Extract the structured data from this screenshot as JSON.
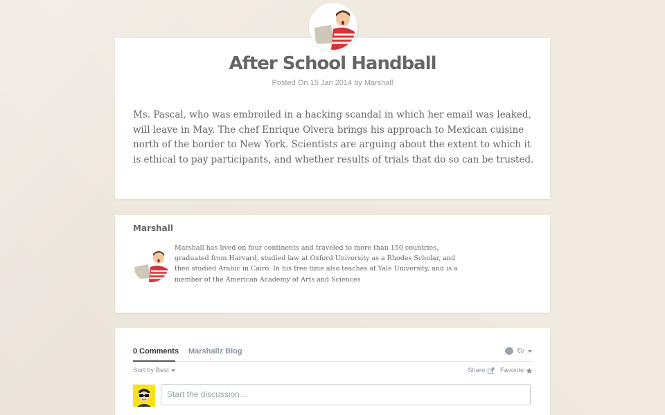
{
  "post": {
    "title": "After School Handball",
    "meta": "Posted On 15 Jan 2014 by Marshall",
    "body": "Ms. Pascal, who was embroiled in a hacking scandal in which her email was leaked, will leave in May. The chef Enrique Olvera brings his approach to Mexican cuisine north of the border to New York. Scientists are arguing about the extent to which it is ethical to pay participants, and whether results of trials that do so can be trusted."
  },
  "author": {
    "name": "Marshall",
    "bio": "Marshall has lived on four continents and traveled to more than 150 countries, graduated from Harvard, studied law at Oxford University as a Rhodes Scholar, and then studied Arabic in Cairo. In his free time also teaches at Yale University, and is a member of the American Academy of Arts and Sciences"
  },
  "comments": {
    "count_tab": "0 Comments",
    "blog_tab": "Marshallz Blog",
    "user_menu": "€v",
    "sort_label": "Sort by Best",
    "share_label": "Share",
    "favorite_label": "Favorite",
    "input_placeholder": "Start the discussion…"
  },
  "colors": {
    "background": "#efe9df",
    "card": "#ffffff",
    "avatar_bg": "#f7e21a"
  },
  "icons": [
    "author-avatar-icon",
    "comment-bubble-icon",
    "share-icon",
    "star-icon",
    "user-avatar-icon"
  ]
}
